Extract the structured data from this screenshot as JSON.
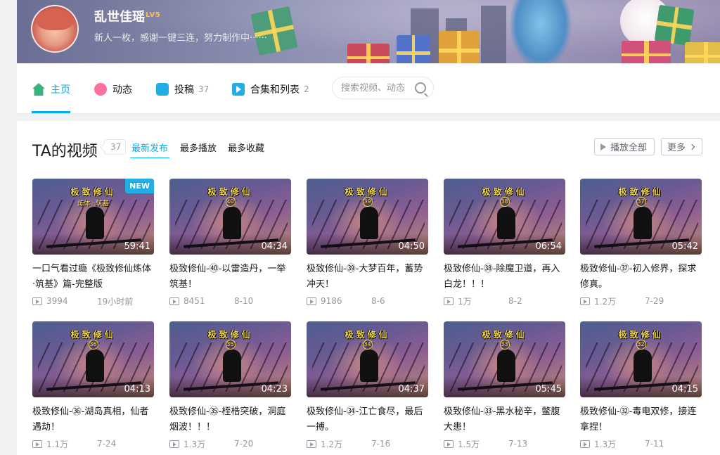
{
  "profile": {
    "name": "乱世佳瑶",
    "level": "LV5",
    "sign": "新人一枚，感谢一键三连，努力制作中······"
  },
  "nav": {
    "home": "主页",
    "dynamic": "动态",
    "posts": "投稿",
    "posts_count": "37",
    "collections": "合集和列表",
    "collections_count": "2",
    "search_placeholder": "搜索视频、动态"
  },
  "section": {
    "title": "TA的视频",
    "count": "37",
    "sort_new": "最新发布",
    "sort_play": "最多播放",
    "sort_fav": "最多收藏",
    "play_all": "播放全部",
    "more": "更多"
  },
  "thumb_text": {
    "title": "极致修仙",
    "first_sub": "炼体 · 筑基",
    "new_badge": "NEW"
  },
  "videos": [
    {
      "episode": "",
      "duration": "59:41",
      "title": "一口气看过瘾《极致修仙炼体·筑基》篇-完整版",
      "plays": "3994",
      "date": "19小时前"
    },
    {
      "episode": "40",
      "duration": "04:34",
      "title": "极致修仙-㊵-以雷造丹，一举筑基！",
      "plays": "8451",
      "date": "8-10"
    },
    {
      "episode": "39",
      "duration": "04:50",
      "title": "极致修仙-㊴-大梦百年，蓄势冲天！",
      "plays": "9186",
      "date": "8-6"
    },
    {
      "episode": "38",
      "duration": "06:54",
      "title": "极致修仙-㊳-除魔卫道，再入白龙！！！",
      "plays": "1万",
      "date": "8-2"
    },
    {
      "episode": "37",
      "duration": "05:42",
      "title": "极致修仙-㊲-初入修界，探求修真。",
      "plays": "1.2万",
      "date": "7-29"
    },
    {
      "episode": "36",
      "duration": "04:13",
      "title": "极致修仙-㊱-湖岛真相，仙者遇劫！",
      "plays": "1.1万",
      "date": "7-24"
    },
    {
      "episode": "35",
      "duration": "04:23",
      "title": "极致修仙-㉟-桎梏突破，洞庭烟波！！！",
      "plays": "1.3万",
      "date": "7-20"
    },
    {
      "episode": "34",
      "duration": "04:37",
      "title": "极致修仙-㉞-江亡食尽，最后一搏。",
      "plays": "1.2万",
      "date": "7-16"
    },
    {
      "episode": "33",
      "duration": "05:45",
      "title": "极致修仙-㉝-黑水秘辛，鳖腹大患！",
      "plays": "1.5万",
      "date": "7-13"
    },
    {
      "episode": "32",
      "duration": "04:15",
      "title": "极致修仙-㉜-毒电双修，接连拿捏！",
      "plays": "1.3万",
      "date": "7-11"
    }
  ]
}
